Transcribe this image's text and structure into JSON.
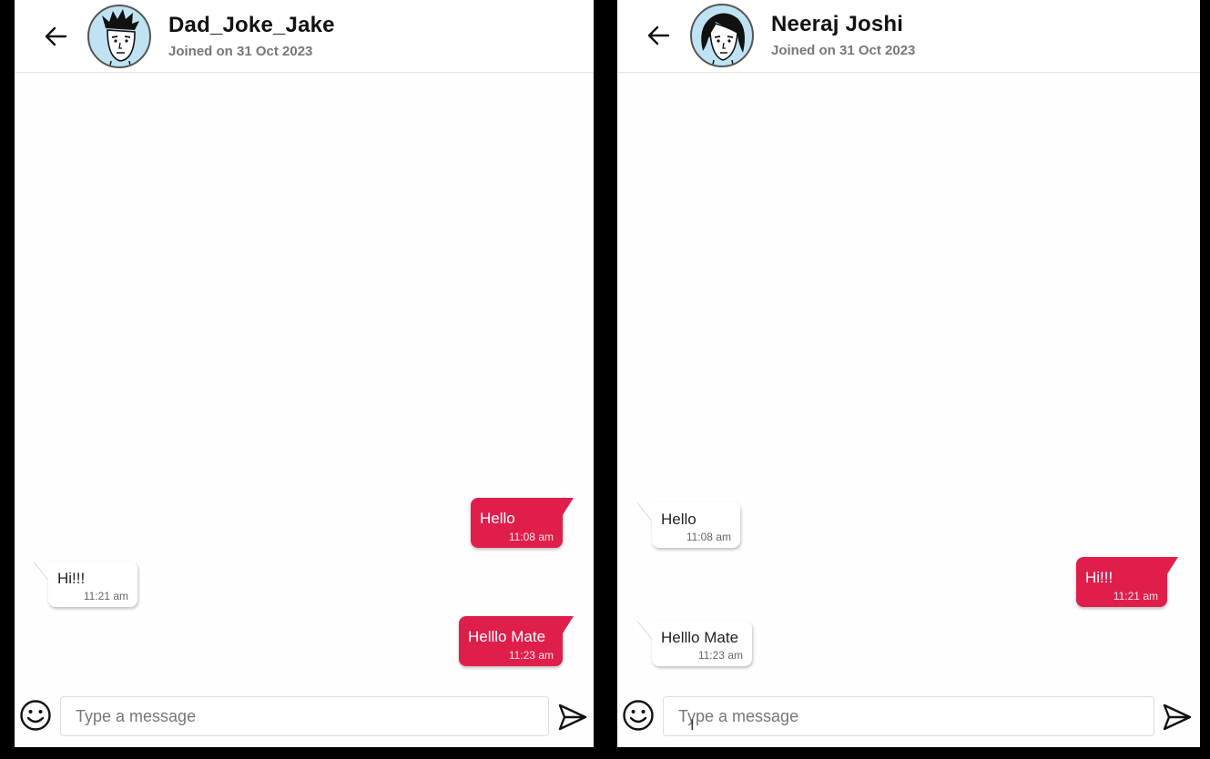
{
  "left": {
    "name": "Dad_Joke_Jake",
    "joined": "Joined on 31 Oct 2023",
    "messages": [
      {
        "text": "Hello",
        "time": "11:08 am"
      },
      {
        "text": "Hi!!!",
        "time": "11:21 am"
      },
      {
        "text": "Helllo Mate",
        "time": "11:23 am"
      }
    ],
    "placeholder": "Type a message"
  },
  "right": {
    "name": "Neeraj Joshi",
    "joined": "Joined on 31 Oct 2023",
    "messages": [
      {
        "text": "Hello",
        "time": "11:08 am"
      },
      {
        "text": "Hi!!!",
        "time": "11:21 am"
      },
      {
        "text": "Helllo Mate",
        "time": "11:23 am"
      }
    ],
    "placeholder": "Type a message"
  },
  "icons": {
    "back": "arrow-left-icon",
    "emoji": "smiley-icon",
    "send": "paper-plane-icon"
  },
  "colors": {
    "sent_bubble": "#e01e4b",
    "received_bubble": "#ffffff",
    "avatar_bg": "#bfe3f2"
  }
}
